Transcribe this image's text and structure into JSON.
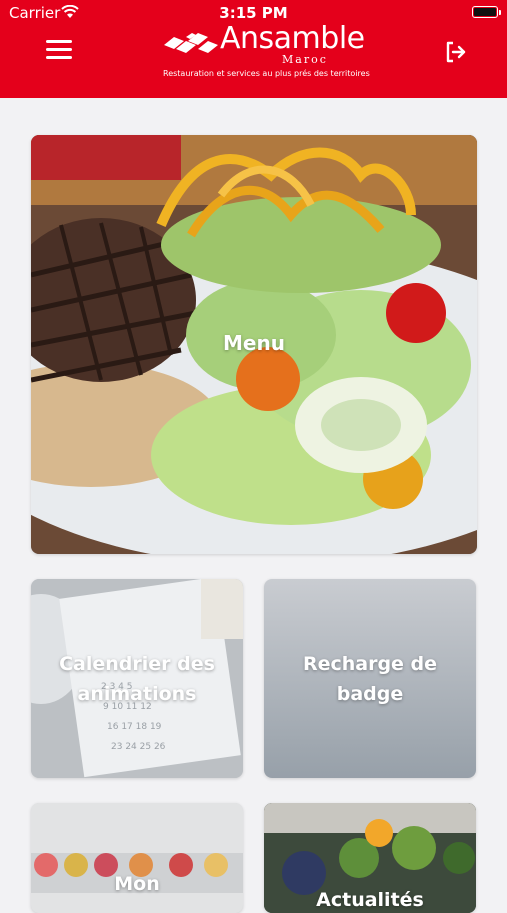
{
  "status_bar": {
    "carrier": "Carrier",
    "time": "3:15 PM"
  },
  "header": {
    "brand": "Ansamble",
    "brand_sub": "Maroc",
    "tagline": "Restauration et services au plus prés des territoires",
    "accent": "#e4001b"
  },
  "tiles": [
    {
      "label": "Menu"
    },
    {
      "label": "Calendrier des animations"
    },
    {
      "label": "Recharge de badge"
    },
    {
      "label": "Mon"
    },
    {
      "label": "Actualités"
    }
  ]
}
